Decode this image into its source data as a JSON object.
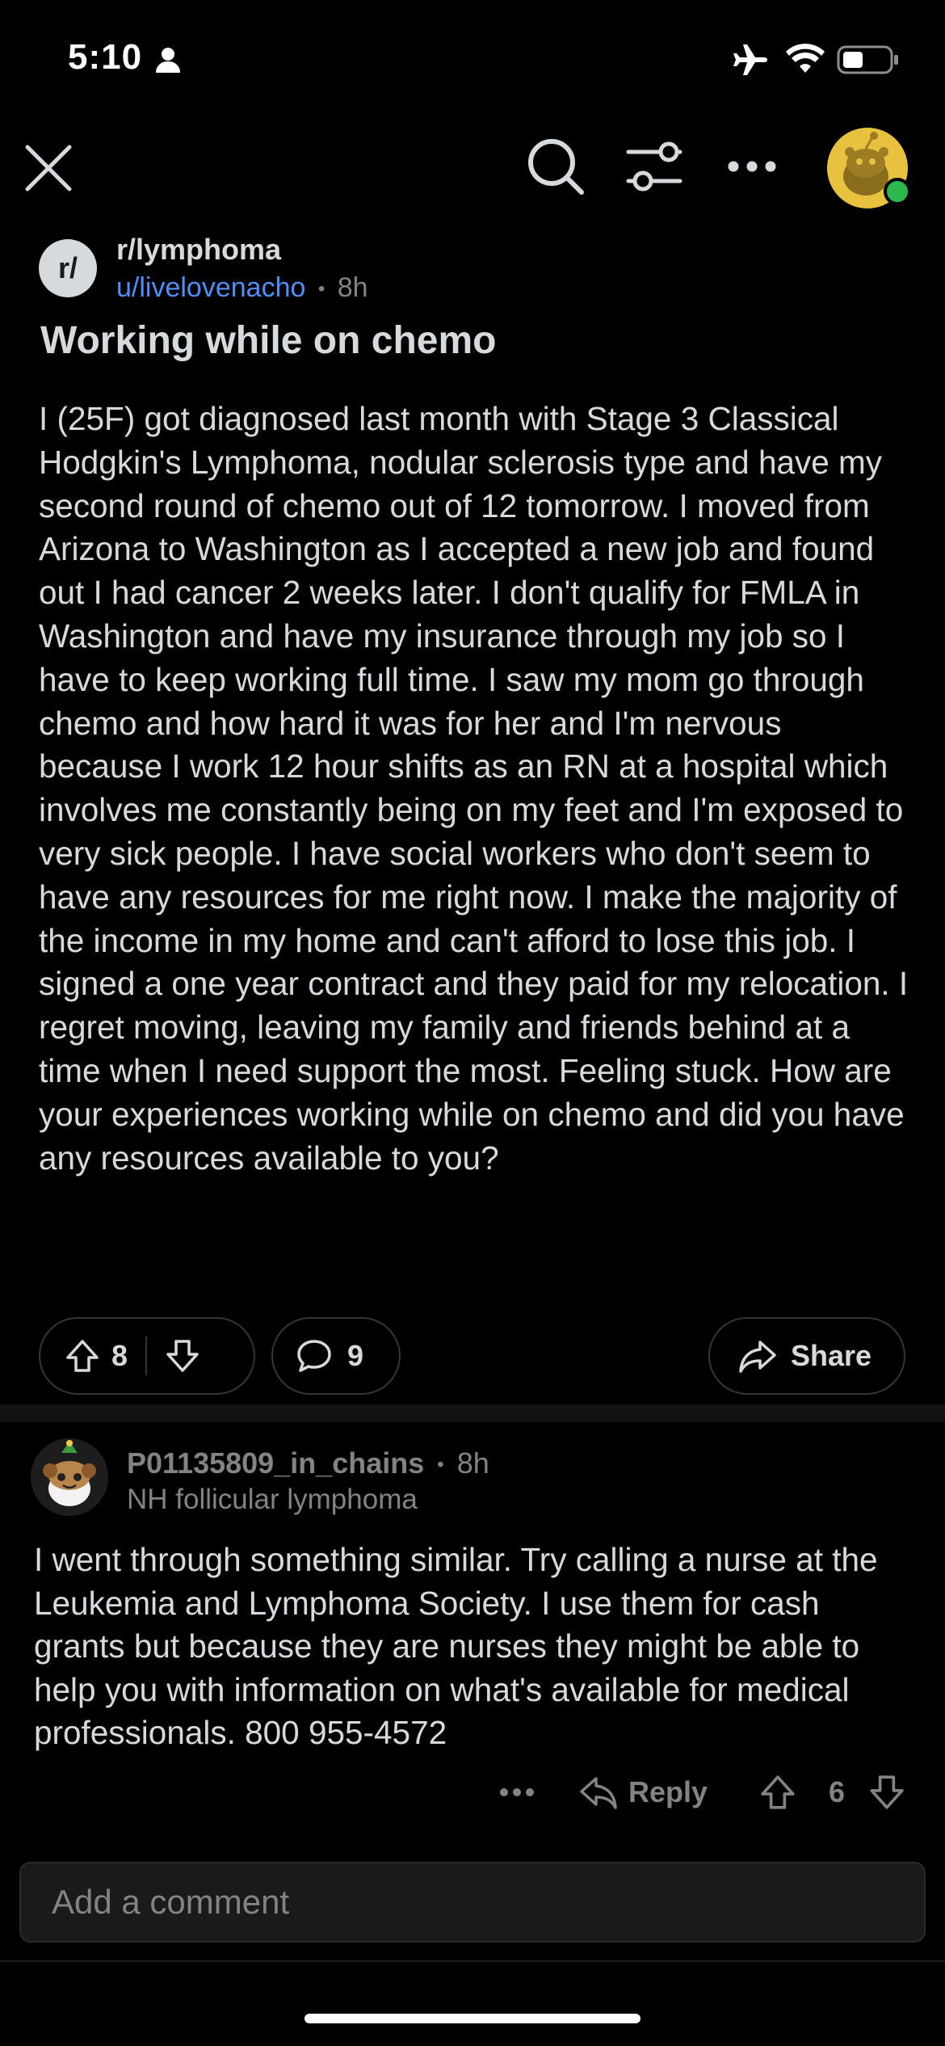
{
  "status_bar": {
    "time": "5:10",
    "icons": [
      "person-icon",
      "airplane-icon",
      "wifi-icon",
      "battery-icon"
    ]
  },
  "header": {
    "icons": [
      "close-icon",
      "search-icon",
      "filter-icon",
      "more-icon",
      "avatar"
    ]
  },
  "post": {
    "subreddit_icon_text": "r/",
    "subreddit": "r/lymphoma",
    "author": "u/livelovenacho",
    "separator": "•",
    "time": "8h",
    "title": "Working while on chemo",
    "body": "I (25F) got diagnosed last month with Stage 3 Classical Hodgkin's Lymphoma, nodular sclerosis type and have my second round of chemo out of 12 tomorrow. I moved from Arizona to Washington as I accepted a new job and found out I had cancer 2 weeks later. I don't qualify for FMLA in Washington and have my insurance through my job so I have to keep working full time. I saw my mom go through chemo and how hard it was for her and I'm nervous because I work 12 hour shifts as an RN at a hospital which involves me constantly being on my feet and I'm exposed to very sick people. I have social workers who don't seem to have any resources for me right now. I make the majority of the income in my home and can't afford to lose this job. I signed a one year contract and they paid for my relocation. I regret moving, leaving my family and friends behind at a time when I need support the most. Feeling stuck. How are your experiences working while on chemo and did you have any resources available to you?",
    "votes": "8",
    "comments": "9",
    "share_label": "Share"
  },
  "comment": {
    "author": "P01135809_in_chains",
    "separator": "•",
    "time": "8h",
    "flair": "NH follicular lymphoma",
    "body": "I went through something similar. Try calling a nurse at the Leukemia and Lymphoma Society. I use them for cash grants but because they are nurses they might be able to help you with information on what's available for medical professionals. 800 955-4572",
    "more": "•••",
    "reply_label": "Reply",
    "votes": "6"
  },
  "composer": {
    "placeholder": "Add a comment"
  },
  "colors": {
    "background": "#000000",
    "text": "#d7dadc",
    "muted": "#818384",
    "link": "#4f8ff7",
    "avatar_bg": "#e8c23f",
    "online": "#2db84d"
  }
}
